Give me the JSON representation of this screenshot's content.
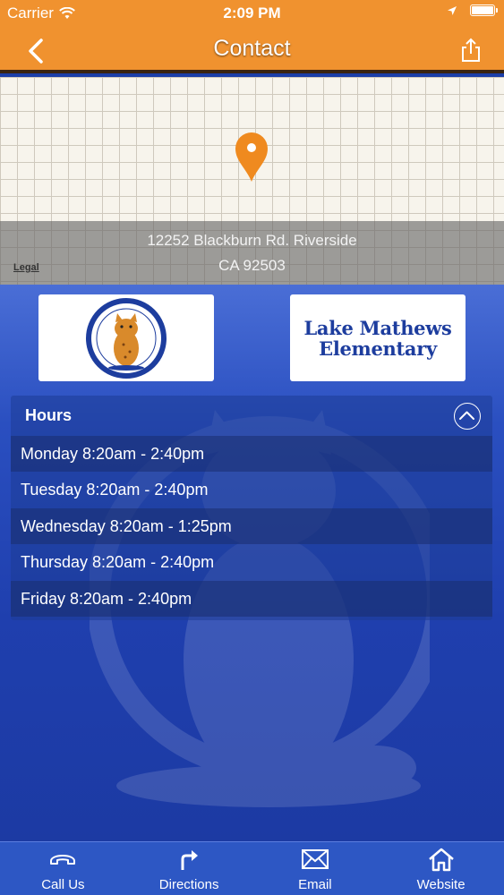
{
  "status": {
    "carrier": "Carrier",
    "time": "2:09 PM"
  },
  "nav": {
    "title": "Contact"
  },
  "map": {
    "address_line1": "12252 Blackburn Rd. Riverside",
    "address_line2": "CA 92503",
    "legal": "Legal"
  },
  "logos": {
    "seal_text": "LAKE MATHEWS ELEMENTARY",
    "brand_line1": "Lake Mathews",
    "brand_line2": "Elementary"
  },
  "hours": {
    "title": "Hours",
    "rows": [
      "Monday 8:20am - 2:40pm",
      "Tuesday 8:20am - 2:40pm",
      "Wednesday 8:20am - 1:25pm",
      "Thursday 8:20am - 2:40pm",
      "Friday 8:20am - 2:40pm"
    ]
  },
  "tabbar": {
    "items": [
      {
        "label": "Call Us",
        "icon": "phone-icon"
      },
      {
        "label": "Directions",
        "icon": "directions-icon"
      },
      {
        "label": "Email",
        "icon": "envelope-icon"
      },
      {
        "label": "Website",
        "icon": "home-icon"
      }
    ]
  },
  "colors": {
    "header": "#f0922f",
    "accent_blue": "#1b3ea8",
    "brand_text": "#1d3d9e"
  }
}
